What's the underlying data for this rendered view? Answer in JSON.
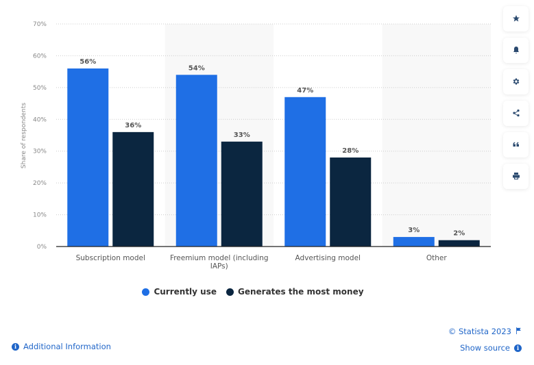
{
  "chart_data": {
    "type": "bar",
    "title": "",
    "xlabel": "",
    "ylabel": "Share of respondents",
    "ylim": [
      0,
      70
    ],
    "yticks": [
      0,
      10,
      20,
      30,
      40,
      50,
      60,
      70
    ],
    "ytick_labels": [
      "0%",
      "10%",
      "20%",
      "30%",
      "40%",
      "50%",
      "60%",
      "70%"
    ],
    "grid": true,
    "categories": [
      "Subscription model",
      "Freemium model (including IAPs)",
      "Advertising model",
      "Other"
    ],
    "category_label_lines": [
      [
        "Subscription model"
      ],
      [
        "Freemium model (including",
        "IAPs)"
      ],
      [
        "Advertising model"
      ],
      [
        "Other"
      ]
    ],
    "series": [
      {
        "name": "Currently use",
        "color": "#1f6fe5",
        "values": [
          56,
          54,
          47,
          3
        ],
        "labels": [
          "56%",
          "54%",
          "47%",
          "3%"
        ]
      },
      {
        "name": "Generates the most money",
        "color": "#0b2640",
        "values": [
          36,
          33,
          28,
          2
        ],
        "labels": [
          "36%",
          "33%",
          "28%",
          "2%"
        ]
      }
    ],
    "legend_position": "bottom-center"
  },
  "legend": [
    {
      "label": "Currently use",
      "color": "#1f6fe5"
    },
    {
      "label": "Generates the most money",
      "color": "#0b2640"
    }
  ],
  "sidebar": {
    "buttons": [
      {
        "name": "favorite",
        "icon": "star-icon"
      },
      {
        "name": "notification",
        "icon": "bell-icon"
      },
      {
        "name": "settings",
        "icon": "gear-icon"
      },
      {
        "name": "share",
        "icon": "share-icon"
      },
      {
        "name": "cite",
        "icon": "quote-icon"
      },
      {
        "name": "print",
        "icon": "printer-icon"
      }
    ]
  },
  "footer": {
    "additional_info": "Additional Information",
    "copyright": "© Statista 2023",
    "show_source": "Show source"
  }
}
